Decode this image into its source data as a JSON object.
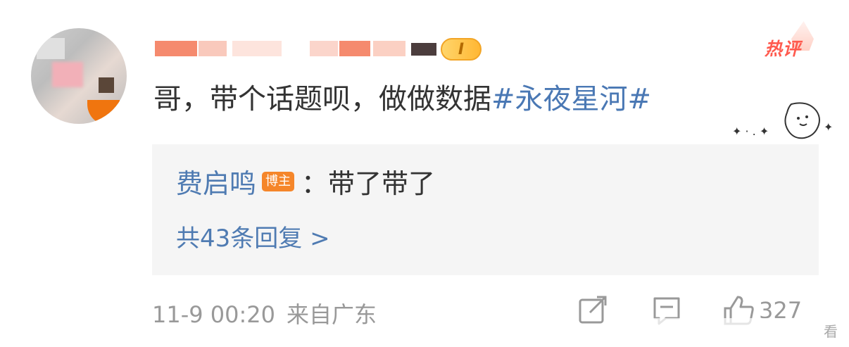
{
  "comment": {
    "hot_tag": "热评",
    "level_badge": "I",
    "text": "哥，带个话题呗，做做数据",
    "topic": "#永夜星河#"
  },
  "reply": {
    "author": "费启鸣",
    "badge": "博主",
    "separator": "：",
    "text": "带了带了",
    "more": "共43条回复 >"
  },
  "meta": {
    "timestamp": "11-9 00:20",
    "source": "来自广东",
    "like_count": "327"
  },
  "watermark": "看",
  "colors": {
    "topic_blue": "#4a78b4",
    "reply_blue": "#4f7bb2",
    "hot_red": "#ff5a4e",
    "badge_orange": "#f5862a",
    "meta_gray": "#999999"
  },
  "icons": [
    "share-icon",
    "comment-icon",
    "like-icon",
    "flame-icon"
  ]
}
